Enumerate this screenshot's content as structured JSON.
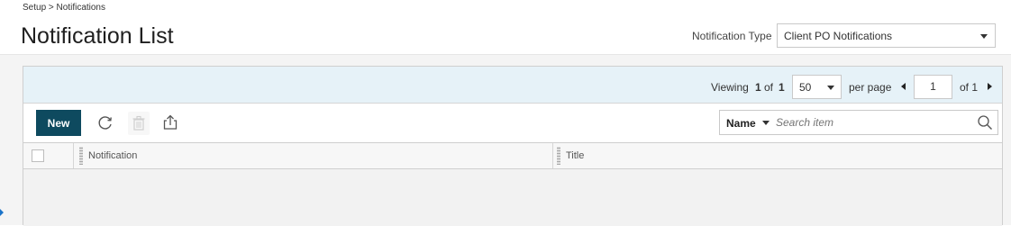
{
  "breadcrumb": "Setup > Notifications",
  "page_title": "Notification List",
  "notification_type": {
    "label": "Notification Type",
    "selected": "Client PO Notifications"
  },
  "pager": {
    "viewing_label": "Viewing",
    "viewing_from": "1",
    "of_label": "of",
    "viewing_total": "1",
    "per_page_value": "50",
    "per_page_label": "per page",
    "page_value": "1",
    "of_pages_label": "of 1"
  },
  "toolbar": {
    "new_label": "New",
    "icons": [
      "refresh-icon",
      "trash-icon",
      "export-icon"
    ]
  },
  "search": {
    "field_label": "Name",
    "placeholder": "Search item"
  },
  "grid": {
    "columns": [
      "Notification",
      "Title"
    ]
  },
  "colors": {
    "primary_button": "#0e4a5f",
    "pager_bar": "#e6f2f8",
    "accent": "#1a73c8"
  }
}
